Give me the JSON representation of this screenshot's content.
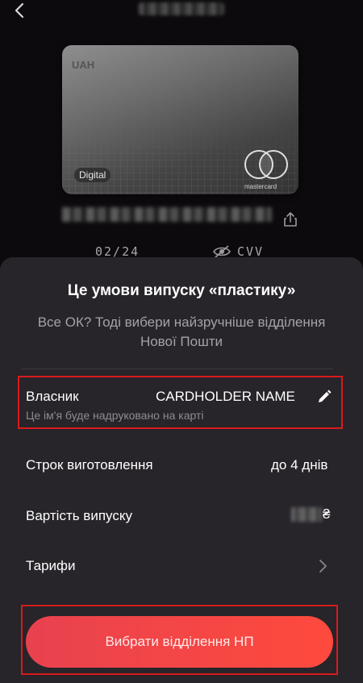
{
  "header": {
    "back_icon": "chevron-left-icon"
  },
  "card": {
    "currency": "UAH",
    "type_badge": "Digital",
    "network_text": "mastercard",
    "expiry": "02/24",
    "cvv_label": "CVV",
    "share_icon": "share-icon",
    "cvv_visibility_icon": "eye-off-icon"
  },
  "sheet": {
    "title": "Це умови випуску «пластику»",
    "subtitle": "Все ОК? Тоді вибери найзручніше відділення Нової Пошти",
    "owner": {
      "label": "Власник",
      "value": "CARDHOLDER NAME",
      "hint": "Це ім'я буде надруковано на карті",
      "edit_icon": "pencil-icon"
    },
    "production_time": {
      "label": "Строк виготовлення",
      "value": "до 4 днів"
    },
    "issue_cost": {
      "label": "Вартість випуску",
      "currency_symbol": "₴"
    },
    "tariffs": {
      "label": "Тарифи",
      "icon": "chevron-right-icon"
    },
    "cta_label": "Вибрати відділення НП"
  },
  "colors": {
    "background": "#0d0a0d",
    "sheet": "#27242a",
    "accent": "#ff4a3d",
    "highlight_border": "#d81b1b"
  }
}
